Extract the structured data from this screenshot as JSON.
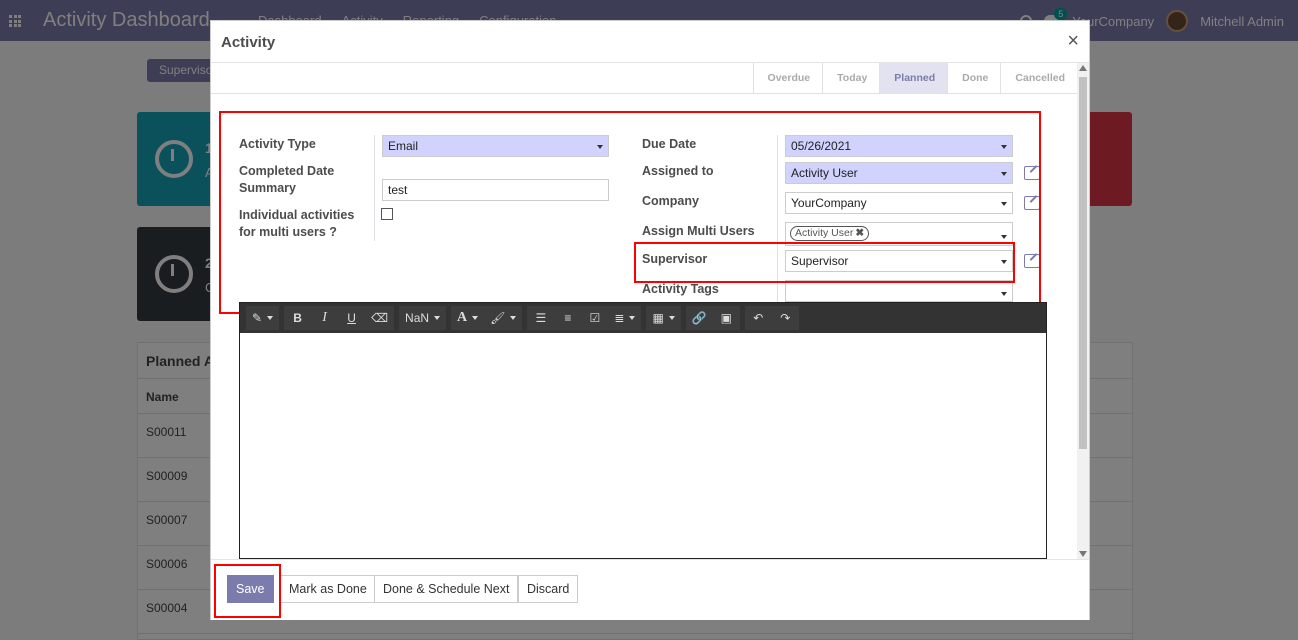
{
  "app": {
    "title": "Activity Dashboard",
    "menu": [
      "Dashboard",
      "Activity",
      "Reporting",
      "Configuration"
    ],
    "company": "YourCompany",
    "user": "Mitchell Admin",
    "chat_count": "5"
  },
  "background": {
    "pill_label": "Superviso",
    "card1_digit": "1",
    "card1_text": "A",
    "card2_digit": "2",
    "card2_text": "C",
    "table_title": "Planned A",
    "column_name": "Name",
    "rows": [
      "S00011",
      "S00009",
      "S00007",
      "S00006",
      "S00004"
    ]
  },
  "modal": {
    "title": "Activity",
    "close": "×",
    "stages": [
      "Overdue",
      "Today",
      "Planned",
      "Done",
      "Cancelled"
    ],
    "active_stage": "Planned",
    "left": {
      "activity_type_label": "Activity Type",
      "activity_type_value": "Email",
      "completed_date_label": "Completed Date",
      "summary_label": "Summary",
      "summary_value": "test",
      "individual_label_1": "Individual activities",
      "individual_label_2": "for multi users ?"
    },
    "right": {
      "due_date_label": "Due Date",
      "due_date_value": "05/26/2021",
      "assigned_to_label": "Assigned to",
      "assigned_to_value": "Activity User",
      "company_label": "Company",
      "company_value": "YourCompany",
      "multi_users_label": "Assign Multi Users",
      "multi_users_tag": "Activity User",
      "supervisor_label": "Supervisor",
      "supervisor_value": "Supervisor",
      "tags_label": "Activity Tags",
      "tags_value": ""
    },
    "toolbar": {
      "font_size": "NaN",
      "bold": "B",
      "italic": "I",
      "underline": "U",
      "color": "A"
    },
    "footer": {
      "save": "Save",
      "mark_done": "Mark as Done",
      "done_schedule": "Done & Schedule Next",
      "discard": "Discard"
    }
  },
  "colors": {
    "brand": "#7c7bad",
    "required_field": "#d2d2ff",
    "highlight": "#ff0000"
  }
}
